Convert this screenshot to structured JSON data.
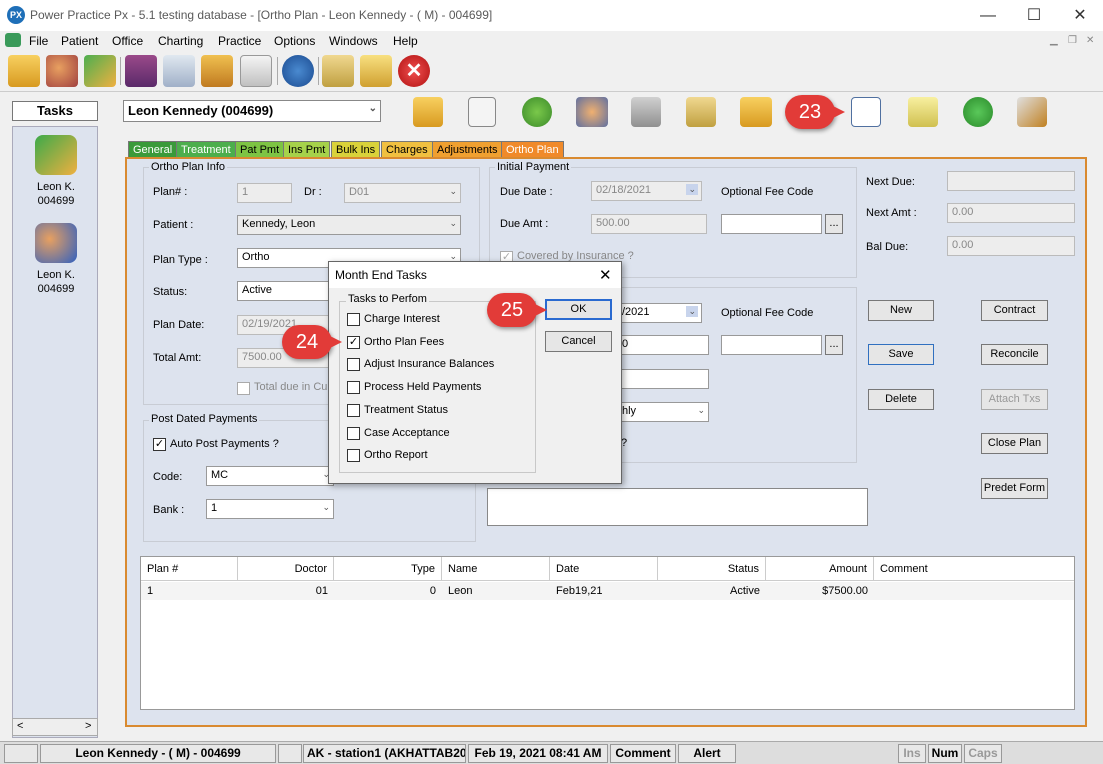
{
  "window": {
    "title": "Power Practice Px - 5.1 testing database - [Ortho Plan - Leon Kennedy - ( M) - 004699]",
    "logo": "PX"
  },
  "menu": [
    "File",
    "Patient",
    "Office",
    "Charting",
    "Practice",
    "Options",
    "Windows",
    "Help"
  ],
  "tasks": {
    "title": "Tasks",
    "items": [
      {
        "label1": "Leon K.",
        "label2": "004699"
      },
      {
        "label1": "Leon K.",
        "label2": "004699"
      }
    ]
  },
  "patient_select": "Leon Kennedy (004699)",
  "tabs": [
    {
      "label": "General",
      "color": "#3a9a3a"
    },
    {
      "label": "Treatment",
      "color": "#4cae4c"
    },
    {
      "label": "Pat Pmt",
      "color": "#7dc443"
    },
    {
      "label": "Ins Pmt",
      "color": "#a6d24a"
    },
    {
      "label": "Bulk Ins",
      "color": "#d9d23a"
    },
    {
      "label": "Charges",
      "color": "#f0c040"
    },
    {
      "label": "Adjustments",
      "color": "#f0a030"
    },
    {
      "label": "Ortho Plan",
      "color": "#f08a2a"
    }
  ],
  "ortho_plan_info": {
    "title": "Ortho Plan Info",
    "plan_label": "Plan# :",
    "plan_value": "1",
    "dr_label": "Dr :",
    "dr_value": "D01",
    "patient_label": "Patient :",
    "patient_value": "Kennedy, Leon",
    "plan_type_label": "Plan Type :",
    "plan_type_value": "Ortho",
    "status_label": "Status:",
    "status_value": "Active",
    "plan_date_label": "Plan Date:",
    "plan_date_value": "02/19/2021",
    "total_amt_label": "Total Amt:",
    "total_amt_value": "7500.00",
    "total_due_label": "Total due in Cur"
  },
  "post_dated": {
    "title": "Post Dated Payments",
    "auto_post_label": "Auto Post Payments ?",
    "code_label": "Code:",
    "code_value": "MC",
    "bank_label": "Bank :",
    "bank_value": "1"
  },
  "initial_payment": {
    "title": "Initial Payment",
    "due_date_label": "Due Date :",
    "due_date_value": "02/18/2021",
    "optional_fee_label": "Optional Fee Code",
    "due_amt_label": "Due Amt :",
    "due_amt_value": "500.00",
    "covered_label": "Covered by Insurance ?"
  },
  "recurring": {
    "date_value": "/2021",
    "optional_fee_label": "Optional Fee Code",
    "amount_value": "0",
    "frequency_value": "hly",
    "question_suffix": "?"
  },
  "right_info": {
    "next_due_label": "Next Due:",
    "next_amt_label": "Next Amt :",
    "next_amt_value": "0.00",
    "bal_due_label": "Bal Due:",
    "bal_due_value": "0.00"
  },
  "buttons": {
    "new": "New",
    "contract": "Contract",
    "save": "Save",
    "reconcile": "Reconcile",
    "delete": "Delete",
    "attach_txs": "Attach Txs",
    "close_plan": "Close Plan",
    "predet_form": "Predet Form"
  },
  "grid": {
    "headers": [
      "Plan #",
      "Doctor",
      "Type",
      "Name",
      "Date",
      "Status",
      "Amount",
      "Comment"
    ],
    "rows": [
      [
        "1",
        "01",
        "0",
        "Leon",
        "Feb19,21",
        "Active",
        "$7500.00",
        ""
      ]
    ]
  },
  "dialog": {
    "title": "Month End Tasks",
    "group_title": "Tasks to Perfom",
    "ok": "OK",
    "cancel": "Cancel",
    "items": [
      {
        "label": "Charge Interest",
        "checked": false
      },
      {
        "label": "Ortho Plan Fees",
        "checked": true
      },
      {
        "label": "Adjust Insurance Balances",
        "checked": false
      },
      {
        "label": "Process Held Payments",
        "checked": false
      },
      {
        "label": "Treatment Status",
        "checked": false
      },
      {
        "label": "Case Acceptance",
        "checked": false
      },
      {
        "label": "Ortho Report",
        "checked": false
      }
    ]
  },
  "callouts": {
    "c23": "23",
    "c24": "24",
    "c25": "25"
  },
  "statusbar": {
    "patient": "Leon Kennedy - ( M) - 004699",
    "station": "AK - station1 (AKHATTAB20",
    "datetime": "Feb 19, 2021 08:41 AM",
    "comment": "Comment",
    "alert": "Alert",
    "ins": "Ins",
    "num": "Num",
    "caps": "Caps"
  },
  "symbols": {
    "check": "✓",
    "close": "✕",
    "arrow_down": "⌄",
    "arrow_left": "<",
    "arrow_right": ">",
    "minimize": "—",
    "maximize": "☐",
    "ellipsis": "..."
  }
}
